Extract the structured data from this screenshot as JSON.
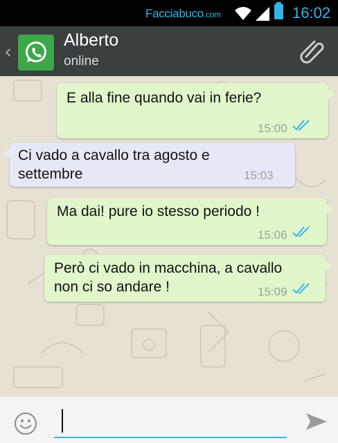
{
  "status_bar": {
    "watermark_main": "Facciabuco",
    "watermark_suffix": ".com",
    "time": "16:02",
    "icons": [
      "wifi-icon",
      "signal-icon",
      "battery-icon"
    ]
  },
  "header": {
    "contact_name": "Alberto",
    "contact_status": "online",
    "icons": [
      "back-icon",
      "whatsapp-avatar-icon",
      "paperclip-icon"
    ]
  },
  "messages": [
    {
      "direction": "outgoing",
      "text": "E alla fine quando vai in ferie?",
      "time": "15:00",
      "status": "read"
    },
    {
      "direction": "incoming",
      "text": "Ci vado a cavallo tra agosto e\nsettembre",
      "time": "15:03"
    },
    {
      "direction": "outgoing",
      "text": "Ma dai! pure io stesso periodo !",
      "time": "15:06",
      "status": "read"
    },
    {
      "direction": "outgoing",
      "text": "Però ci vado in macchina, a cavallo\nnon ci so andare !",
      "time": "15:09",
      "status": "read"
    }
  ],
  "composer": {
    "value": "",
    "icons": [
      "emoji-icon",
      "send-icon"
    ]
  },
  "colors": {
    "outgoing_bubble": "#e1f6cb",
    "incoming_bubble": "#e6e8f6",
    "read_ticks": "#34b7f1",
    "header_bg": "#3a3f40",
    "accent": "#33b5e5"
  }
}
